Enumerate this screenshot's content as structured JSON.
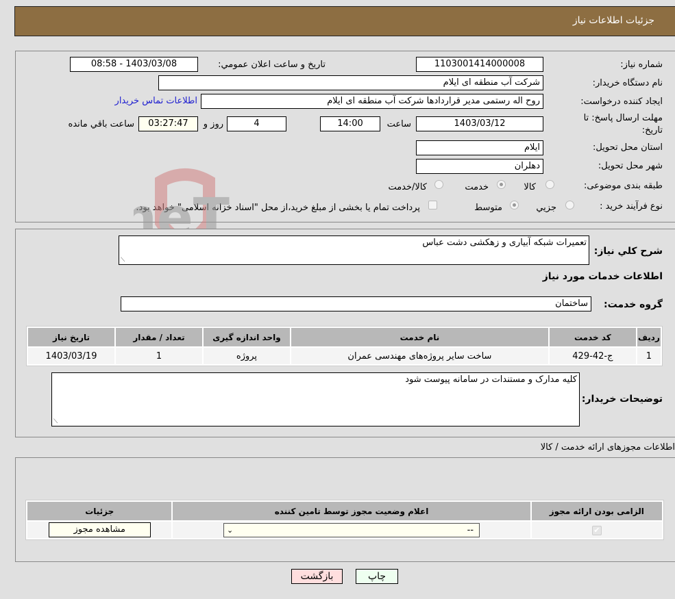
{
  "header": {
    "title": "جزئیات اطلاعات نیاز"
  },
  "details": {
    "need_number_label": "شماره نیاز:",
    "need_number": "1103001414000008",
    "announce_label": "تاریخ و ساعت اعلان عمومي:",
    "announce_value": "1403/03/08 - 08:58",
    "buyer_org_label": "نام دستگاه خریدار:",
    "buyer_org": "شرکت آب منطقه ای ایلام",
    "creator_label": "ایجاد کننده درخواست:",
    "creator": "روح اله رستمی مدیر قراردادها شرکت آب منطقه ای ایلام",
    "contact_link": "اطلاعات تماس خریدار",
    "deadline_label_1": "مهلت ارسال پاسخ: تا",
    "deadline_label_2": "تاریخ:",
    "deadline_date": "1403/03/12",
    "time_label": "ساعت",
    "deadline_time": "14:00",
    "days_value": "4",
    "days_label": "روز و",
    "remaining_time": "03:27:47",
    "remaining_label": "ساعت باقي مانده",
    "province_label": "استان محل تحویل:",
    "province": "ایلام",
    "city_label": "شهر محل تحویل:",
    "city": "دهلران",
    "category_label": "طبقه بندی موضوعی:",
    "category_options": [
      {
        "label": "کالا",
        "selected": false
      },
      {
        "label": "خدمت",
        "selected": true
      },
      {
        "label": "کالا/خدمت",
        "selected": false
      }
    ],
    "process_label": "نوع فرآیند خرید :",
    "process_options": [
      {
        "label": "جزيي",
        "selected": false
      },
      {
        "label": "متوسط",
        "selected": true
      }
    ],
    "treasury_checkbox_label": "پرداخت تمام یا بخشی از مبلغ خرید،از محل \"اسناد خزانه اسلامی\" خواهد بود.",
    "treasury_checked": false
  },
  "watermark": {
    "text": "AriaTender.neT"
  },
  "service": {
    "summary_label": "شرح کلي نیاز:",
    "summary": "تعمیرات شبکه آبیاری و زهکشی دشت عباس",
    "section_title": "اطلاعات خدمات مورد نیاز",
    "group_label": "گروه خدمت:",
    "group": "ساختمان",
    "table": {
      "headers": [
        "ردیف",
        "کد خدمت",
        "نام خدمت",
        "واحد اندازه گیری",
        "تعداد / مقدار",
        "تاریخ نیاز"
      ],
      "rows": [
        [
          "1",
          "ج-42-429",
          "ساخت سایر پروژه‌های مهندسی عمران",
          "پروژه",
          "1",
          "1403/03/19"
        ]
      ]
    },
    "buyer_notes_label": "توضیحات خریدار:",
    "buyer_notes": "کلیه مدارک و مستندات در سامانه پیوست شود"
  },
  "permits": {
    "section_title": "اطلاعات مجوزهای ارائه خدمت / کالا",
    "headers": [
      "الزامی بودن ارائه مجوز",
      "اعلام وضعیت مجوز توسط تامین کننده",
      "جزئیات"
    ],
    "row": {
      "required_checked": true,
      "status_value": "--",
      "view_button": "مشاهده مجوز"
    }
  },
  "actions": {
    "print": "چاپ",
    "back": "بازگشت"
  }
}
